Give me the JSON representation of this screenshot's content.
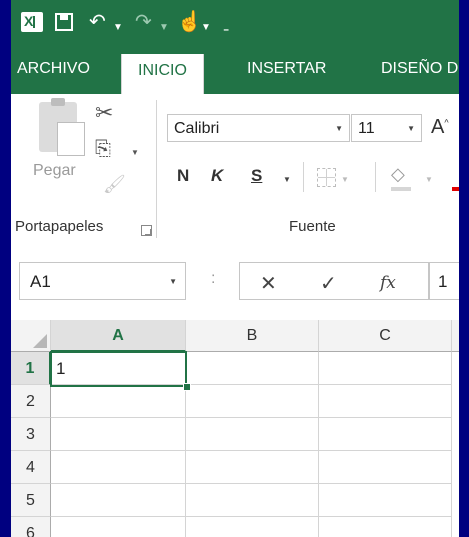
{
  "qat": {
    "app_icon": "excel-logo-icon",
    "save_icon": "save-icon",
    "undo_icon": "undo-icon",
    "redo_icon": "redo-icon",
    "touch_icon": "touch-mode-icon",
    "customize_icon": "customize-qat-icon"
  },
  "tabs": [
    {
      "label": "ARCHIVO",
      "active": false
    },
    {
      "label": "INICIO",
      "active": true
    },
    {
      "label": "INSERTAR",
      "active": false
    },
    {
      "label": "DISEÑO D",
      "active": false
    }
  ],
  "ribbon": {
    "clipboard": {
      "paste_label": "Pegar",
      "group_label": "Portapapeles"
    },
    "font": {
      "name": "Calibri",
      "size": "11",
      "bold_label": "N",
      "italic_label": "K",
      "underline_label": "S",
      "group_label": "Fuente",
      "font_color": "#e00000"
    }
  },
  "formula_bar": {
    "name_box": "A1",
    "colon": ":",
    "cancel": "✕",
    "enter": "✓",
    "fx": "fx",
    "value": "1"
  },
  "grid": {
    "columns": [
      "A",
      "B",
      "C"
    ],
    "rows": [
      "1",
      "2",
      "3",
      "4",
      "5",
      "6"
    ],
    "active_cell": "A1",
    "cells": {
      "A1": "1"
    }
  },
  "colors": {
    "accent": "#217346",
    "background": "#000080"
  }
}
